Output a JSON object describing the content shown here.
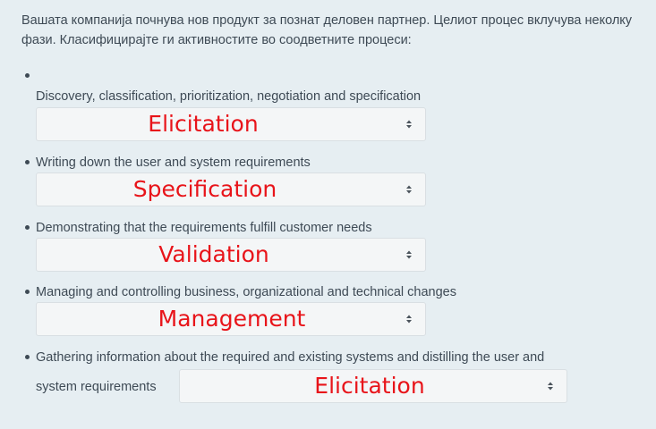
{
  "question": {
    "text": "Вашата компанија почнува нов продукт за познат деловен партнер. Целиот процес вклучува неколку фази. Класифицирајте ги активностите во соодветните процеси:"
  },
  "items": [
    {
      "text": "Discovery, classification, prioritization, negotiation and specification",
      "answer": "Elicitation"
    },
    {
      "text": "Writing down the user and system requirements",
      "answer": "Specification"
    },
    {
      "text": "Demonstrating that the requirements fulfill customer needs",
      "answer": "Validation"
    },
    {
      "text": "Managing and controlling business, organizational and technical changes",
      "answer": "Management"
    },
    {
      "text_line1": "Gathering information about the required and existing systems and distilling the user and",
      "text_line2": "system requirements",
      "answer": "Elicitation"
    }
  ],
  "icons": {
    "bullet": "bullet-dot",
    "select_caret": "chevron-up-down-icon"
  },
  "colors": {
    "background": "#e6eef2",
    "answer_text": "#e8141a",
    "select_bg": "#f4f6f7"
  }
}
